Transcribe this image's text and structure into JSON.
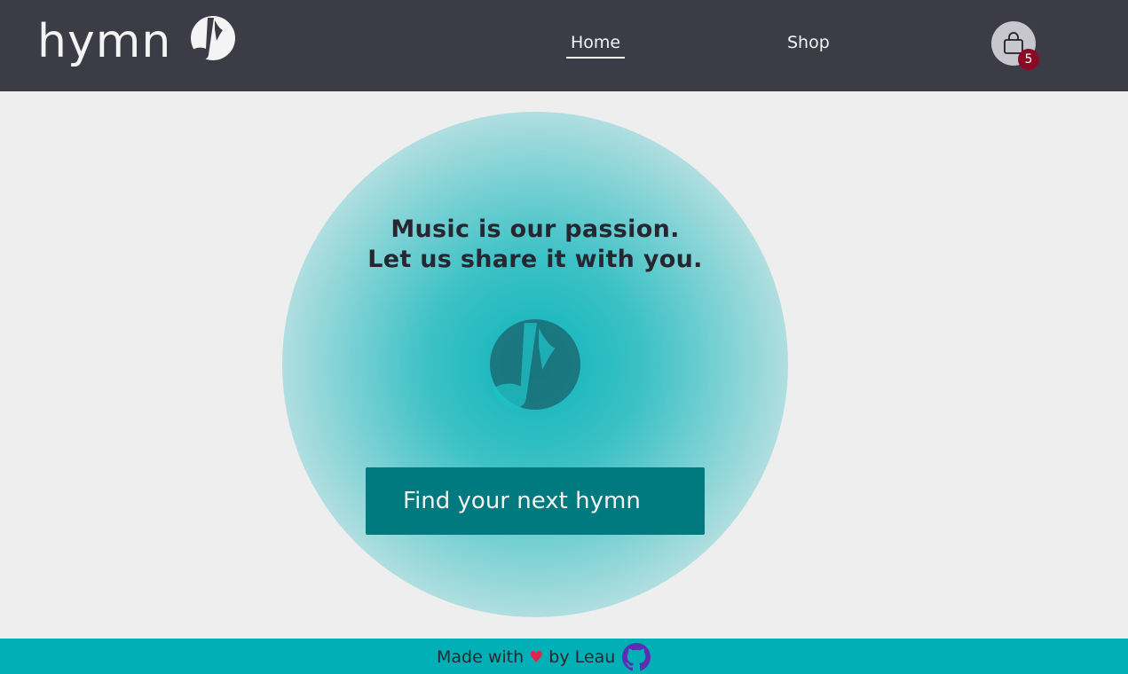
{
  "header": {
    "brand_name": "hymn",
    "brand_logo_icon": "music-note-logo-icon",
    "nav": [
      {
        "label": "Home",
        "active": true
      },
      {
        "label": "Shop",
        "active": false
      }
    ],
    "cart": {
      "icon": "shopping-bag-icon",
      "count": "5"
    }
  },
  "hero": {
    "headline_line1": "Music is our passion.",
    "headline_line2": "Let us share it with you.",
    "logo_icon": "music-note-logo-icon",
    "cta_label": "Find your next hymn"
  },
  "footer": {
    "text_before": "Made with",
    "heart": "♥",
    "text_after": "by Leau",
    "link_icon": "github-icon"
  },
  "colors": {
    "header_bg": "#3b3c46",
    "page_bg": "#eeeeee",
    "accent": "#00b2b8",
    "cta_bg": "#007a7e",
    "badge_bg": "#8c0a25",
    "footer_bg": "#00b0b6"
  }
}
